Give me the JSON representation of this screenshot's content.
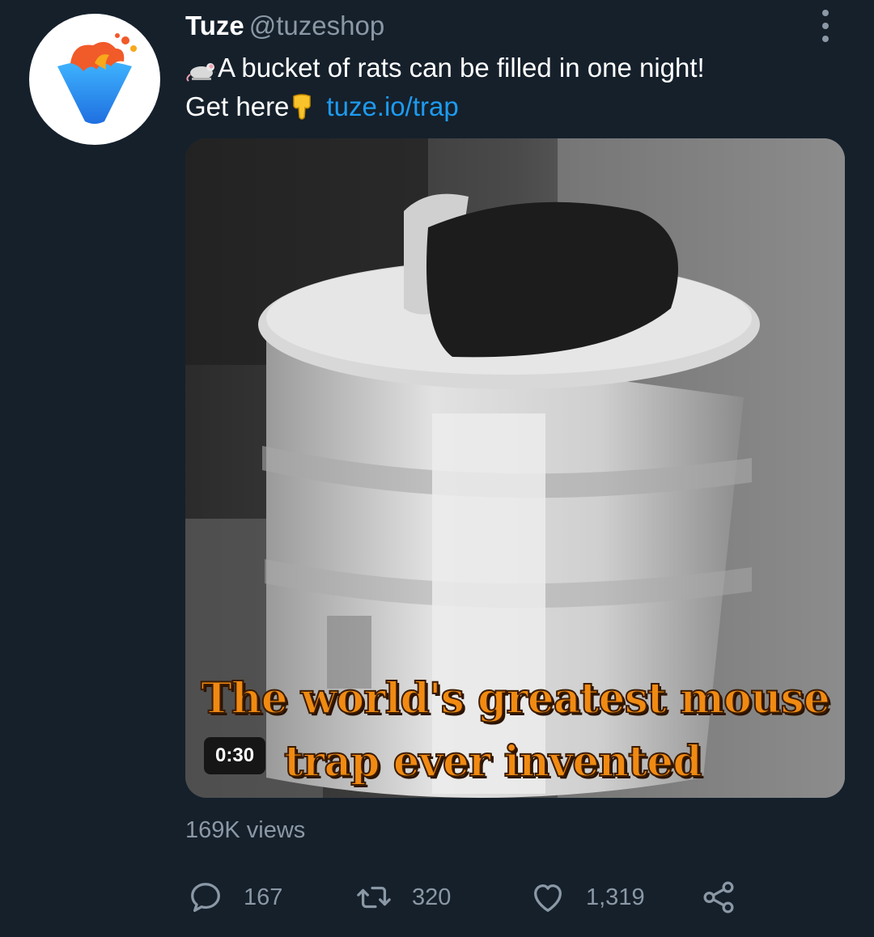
{
  "author": {
    "display_name": "Tuze",
    "handle": "@tuzeshop",
    "avatar_icon": "tuze-logo-icon"
  },
  "tweet": {
    "line1": "A bucket of rats can be filled in one night!",
    "line1_icon": "mouse-emoji",
    "line2": "Get here",
    "line2_icon": "pointing-down-emoji",
    "link": "tuze.io/trap"
  },
  "media": {
    "caption_line1": "The world's greatest mouse",
    "caption_line2": "trap ever invented",
    "duration": "0:30"
  },
  "views": "169K views",
  "actions": {
    "reply": {
      "icon": "reply-icon",
      "count": "167"
    },
    "retweet": {
      "icon": "retweet-icon",
      "count": "320"
    },
    "like": {
      "icon": "heart-icon",
      "count": "1,319"
    },
    "share": {
      "icon": "share-icon"
    }
  },
  "colors": {
    "background": "#15202b",
    "link": "#1d9bf0",
    "muted": "#8b98a5",
    "caption": "#f08a12"
  }
}
